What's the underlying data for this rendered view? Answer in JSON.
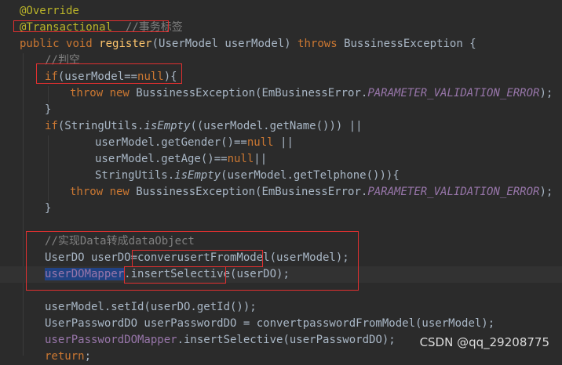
{
  "editor": {
    "lines": [
      {
        "parts": [
          {
            "t": "@Override",
            "c": "ann"
          }
        ]
      },
      {
        "parts": [
          {
            "t": "@Transactional",
            "c": "ann"
          },
          {
            "t": "  //事务标签",
            "c": "cmt"
          }
        ]
      },
      {
        "parts": [
          {
            "t": "public ",
            "c": "kw"
          },
          {
            "t": "void ",
            "c": "kw"
          },
          {
            "t": "register",
            "c": "fn"
          },
          {
            "t": "(UserModel userModel) "
          },
          {
            "t": "throws ",
            "c": "kw"
          },
          {
            "t": "BussinessException {"
          }
        ]
      },
      {
        "parts": [
          {
            "t": "//判空",
            "c": "cmt"
          }
        ]
      },
      {
        "parts": [
          {
            "t": "if",
            "c": "kw"
          },
          {
            "t": "(userModel=="
          },
          {
            "t": "null",
            "c": "kw"
          },
          {
            "t": "){"
          }
        ]
      },
      {
        "parts": [
          {
            "t": "throw ",
            "c": "kw"
          },
          {
            "t": "new ",
            "c": "kw"
          },
          {
            "t": "BussinessException(EmBusinessError."
          },
          {
            "t": "PARAMETER_VALIDATION_ERROR",
            "c": "cst"
          },
          {
            "t": ");"
          }
        ]
      },
      {
        "parts": [
          {
            "t": "}"
          }
        ]
      },
      {
        "parts": [
          {
            "t": "if",
            "c": "kw"
          },
          {
            "t": "(StringUtils."
          },
          {
            "t": "isEmpty",
            "c": "ital"
          },
          {
            "t": "((userModel.getName())) ||"
          }
        ]
      },
      {
        "parts": [
          {
            "t": "userModel.getGender()=="
          },
          {
            "t": "null",
            "c": "kw"
          },
          {
            "t": " ||"
          }
        ]
      },
      {
        "parts": [
          {
            "t": "userModel.getAge()=="
          },
          {
            "t": "null",
            "c": "kw"
          },
          {
            "t": "||"
          }
        ]
      },
      {
        "parts": [
          {
            "t": "StringUtils."
          },
          {
            "t": "isEmpty",
            "c": "ital"
          },
          {
            "t": "(userModel.getTelphone())){"
          }
        ]
      },
      {
        "parts": [
          {
            "t": "throw ",
            "c": "kw"
          },
          {
            "t": "new ",
            "c": "kw"
          },
          {
            "t": "BussinessException(EmBusinessError."
          },
          {
            "t": "PARAMETER_VALIDATION_ERROR",
            "c": "cst"
          },
          {
            "t": ");"
          }
        ]
      },
      {
        "parts": [
          {
            "t": "}"
          }
        ]
      },
      {
        "parts": []
      },
      {
        "parts": [
          {
            "t": "//实现Data转成dataObject",
            "c": "cmt"
          }
        ]
      },
      {
        "parts": [
          {
            "t": "UserDO userDO=converusertFromModel(userModel);"
          }
        ]
      },
      {
        "parts": [
          {
            "t": "userDOMapper",
            "c": "sel"
          },
          {
            "t": ".insertSelective(userDO);"
          }
        ]
      },
      {
        "parts": []
      },
      {
        "parts": [
          {
            "t": "userModel.setId(userDO.getId());"
          }
        ]
      },
      {
        "parts": [
          {
            "t": "UserPasswordDO userPasswordDO = convertpasswordFromModel(userModel);"
          }
        ]
      },
      {
        "parts": [
          {
            "t": "userPasswordDOMapper",
            "c": "fld"
          },
          {
            "t": ".insertSelective(userPasswordDO);"
          }
        ]
      },
      {
        "parts": [
          {
            "t": "return",
            "c": "kw"
          },
          {
            "t": ";"
          }
        ]
      }
    ]
  },
  "watermark": "CSDN @qq_29208775",
  "colors": {
    "background": "#2b2b2b",
    "keyword": "#cc7832",
    "annotation": "#bbb529",
    "method_declaration": "#ffc66d",
    "comment": "#808080",
    "constant": "#9876aa",
    "highlight_box": "#e03030",
    "selection": "#214283"
  }
}
